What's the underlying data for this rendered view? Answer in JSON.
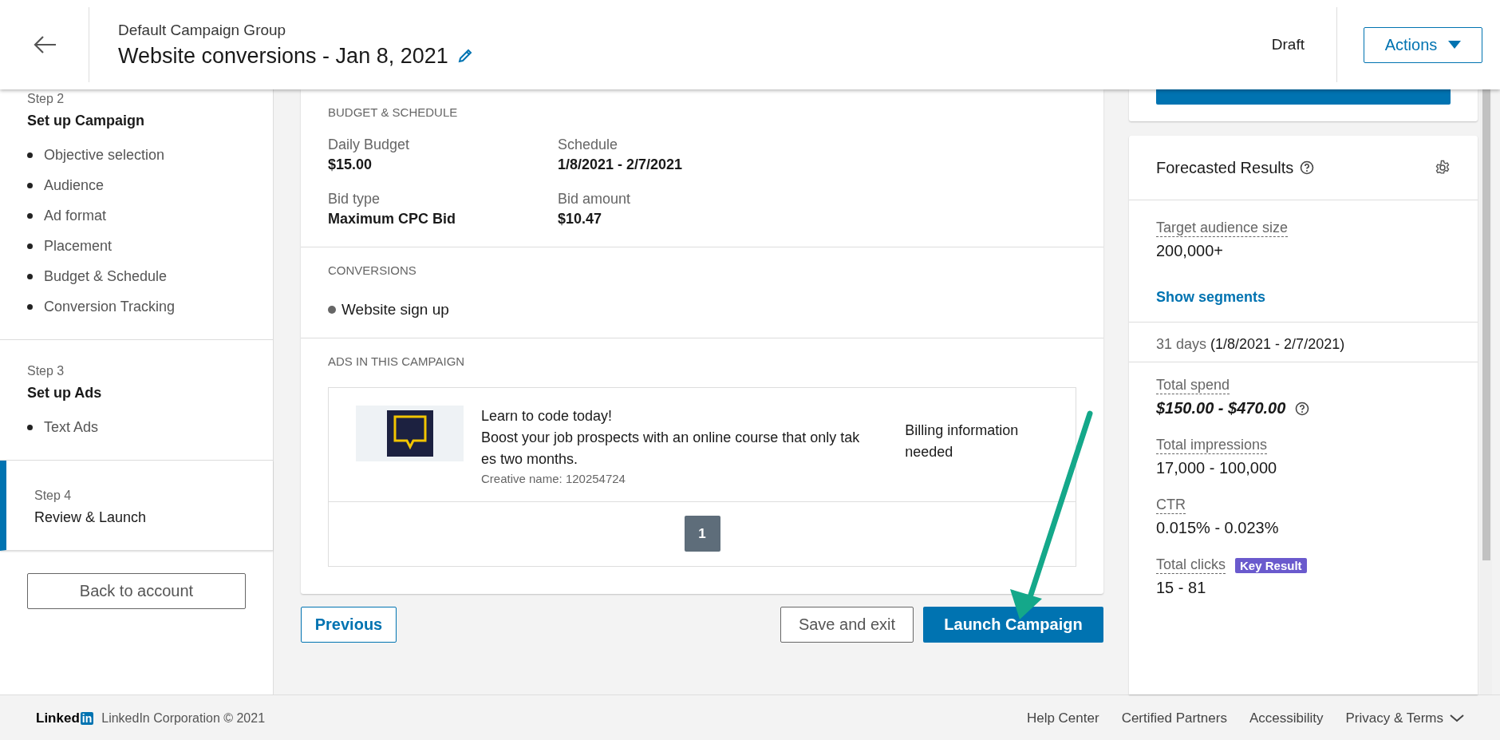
{
  "header": {
    "group": "Default Campaign Group",
    "title": "Website conversions - Jan 8, 2021",
    "status": "Draft",
    "actions_button": "Actions"
  },
  "sidebar": {
    "steps": [
      {
        "step": "Step 2",
        "title": "Set up Campaign",
        "selected": false,
        "items": [
          "Objective selection",
          "Audience",
          "Ad format",
          "Placement",
          "Budget & Schedule",
          "Conversion Tracking"
        ]
      },
      {
        "step": "Step 3",
        "title": "Set up Ads",
        "selected": false,
        "items": [
          "Text Ads"
        ]
      },
      {
        "step": "Step 4",
        "title": "Review & Launch",
        "selected": true
      }
    ],
    "back_button": "Back to account"
  },
  "summary": {
    "budget_section": {
      "heading": "BUDGET & SCHEDULE",
      "fields": [
        {
          "label": "Daily Budget",
          "value": "$15.00"
        },
        {
          "label": "Schedule",
          "value": "1/8/2021 - 2/7/2021"
        },
        {
          "label": "Bid type",
          "value": "Maximum CPC Bid"
        },
        {
          "label": "Bid amount",
          "value": "$10.47"
        }
      ]
    },
    "conversions": {
      "heading": "CONVERSIONS",
      "items": [
        "Website sign up"
      ]
    },
    "ads": {
      "heading": "ADS IN THIS CAMPAIGN",
      "ads": [
        {
          "headline": "Learn to code today!",
          "body": "Boost your job prospects with an online course that only takes two months.",
          "creative_name": "Creative name: 120254724",
          "status": "Billing information needed"
        }
      ],
      "pages": [
        {
          "label": "1",
          "selected": true
        }
      ]
    }
  },
  "actions": {
    "previous": "Previous",
    "save": "Save and exit",
    "launch": "Launch Campaign"
  },
  "forecast": {
    "title": "Forecasted Results",
    "audience_label": "Target audience size",
    "audience_value": "200,000+",
    "segments_link": "Show segments",
    "duration": "31 days",
    "date_range": "(1/8/2021 - 2/7/2021)",
    "metrics": [
      {
        "label": "Total spend",
        "value": "$150.00 - $470.00",
        "kind": "cost"
      },
      {
        "label": "Total impressions",
        "value": "17,000 - 100,000",
        "kind": "plain"
      },
      {
        "label": "CTR",
        "value": "0.015% - 0.023%",
        "kind": "plain"
      },
      {
        "label": "Total clicks",
        "value": "15 - 81",
        "kind": "plain",
        "badge": "Key Result"
      }
    ]
  },
  "page_footer": {
    "logo_text": "Linked",
    "logo_mark": "in",
    "copyright": "LinkedIn Corporation © 2021",
    "links": [
      "Help Center",
      "Certified Partners",
      "Accessibility",
      "Privacy & Terms"
    ]
  }
}
